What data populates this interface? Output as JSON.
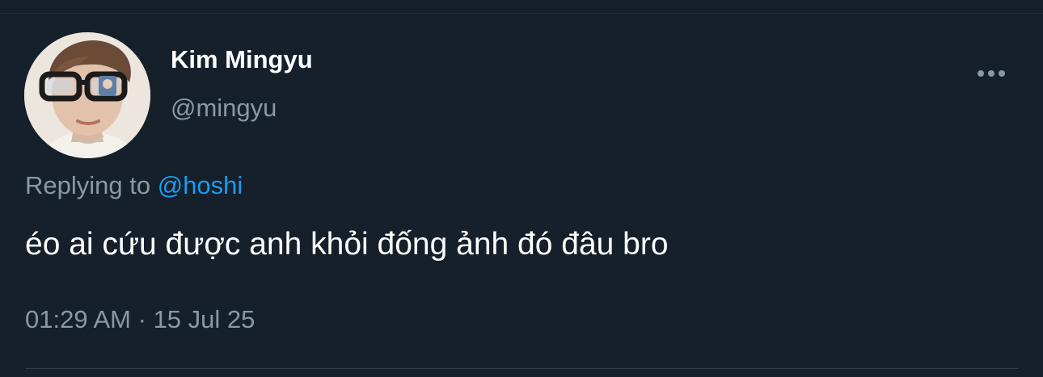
{
  "author": {
    "display_name": "Kim Mingyu",
    "handle": "@mingyu",
    "avatar_icon": "avatar-photo"
  },
  "more_icon": "more-horizontal-icon",
  "reply": {
    "label": "Replying to",
    "mention": "@hoshi"
  },
  "tweet": {
    "text": "éo ai cứu được anh khỏi đống ảnh đó đâu bro",
    "time": "01:29 AM",
    "separator": "·",
    "date": "15 Jul 25"
  },
  "colors": {
    "background": "#15202b",
    "secondary_text": "#8b98a5",
    "link": "#1d9bf0",
    "primary_text": "#ffffff"
  }
}
